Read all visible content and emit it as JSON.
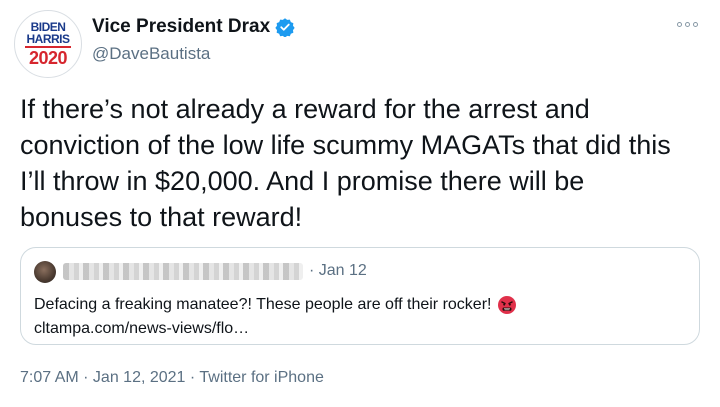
{
  "author": {
    "display_name": "Vice President Drax",
    "handle": "@DaveBautista",
    "avatar_text": {
      "line1": "BIDEN",
      "line2": "HARRIS",
      "line3": "2020"
    }
  },
  "tweet": {
    "text": "If there’s not already a reward for the arrest and\nconviction of the low life scummy MAGATs that did this\nI’ll throw in $20,000. And I promise there will be\nbonuses to that reward!"
  },
  "quoted_tweet": {
    "date": "· Jan 12",
    "text": "Defacing a freaking manatee?! These people are off their rocker!",
    "link": "cltampa.com/news-views/flo…"
  },
  "meta": {
    "timestamp": "7:07 AM · Jan 12, 2021 · Twitter for iPhone"
  },
  "colors": {
    "verified": "#1d9bf0",
    "secondary_text": "#5b7083",
    "border": "#cfd9de"
  },
  "icons": [
    "verified-badge-icon",
    "more-options-icon",
    "angry-emoji-icon"
  ]
}
